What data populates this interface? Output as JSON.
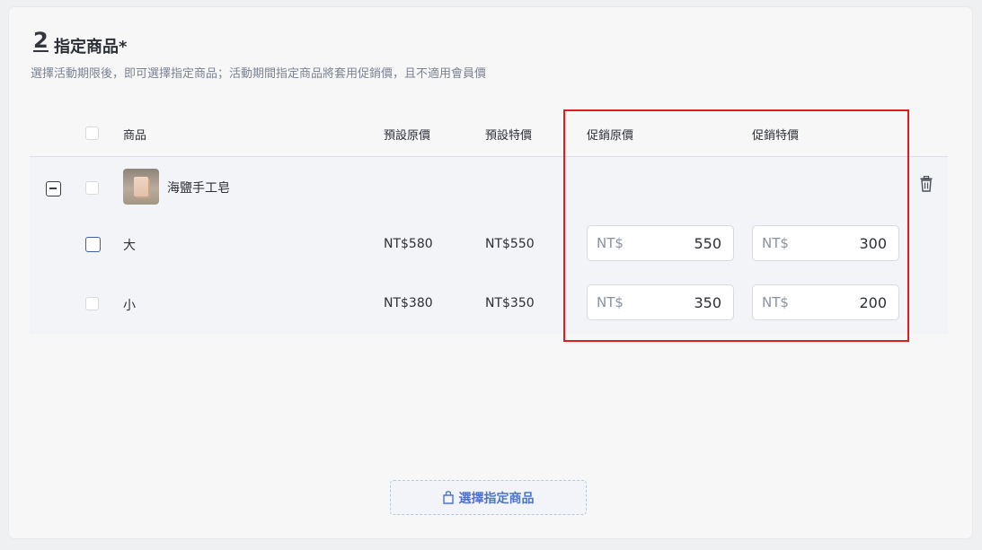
{
  "section": {
    "step": "2",
    "title": "指定商品*",
    "subtitle": "選擇活動期限後，即可選擇指定商品；活動期間指定商品將套用促銷價，且不適用會員價"
  },
  "table": {
    "headers": {
      "product": "商品",
      "default_original": "預設原價",
      "default_special": "預設特價",
      "promo_original": "促銷原價",
      "promo_special": "促銷特價"
    },
    "product": {
      "name": "海鹽手工皂",
      "thumbnail": "soap-photo"
    },
    "variants": [
      {
        "name": "大",
        "default_original": "NT$580",
        "default_special": "NT$550",
        "promo_original_prefix": "NT$",
        "promo_original_value": "550",
        "promo_special_prefix": "NT$",
        "promo_special_value": "300"
      },
      {
        "name": "小",
        "default_original": "NT$380",
        "default_special": "NT$350",
        "promo_original_prefix": "NT$",
        "promo_original_value": "350",
        "promo_special_prefix": "NT$",
        "promo_special_value": "200"
      }
    ]
  },
  "select_button": {
    "label": "選擇指定商品",
    "icon": "shopping-bag-icon"
  },
  "colors": {
    "highlight": "#e21c1c",
    "accent": "#4d74c9"
  }
}
